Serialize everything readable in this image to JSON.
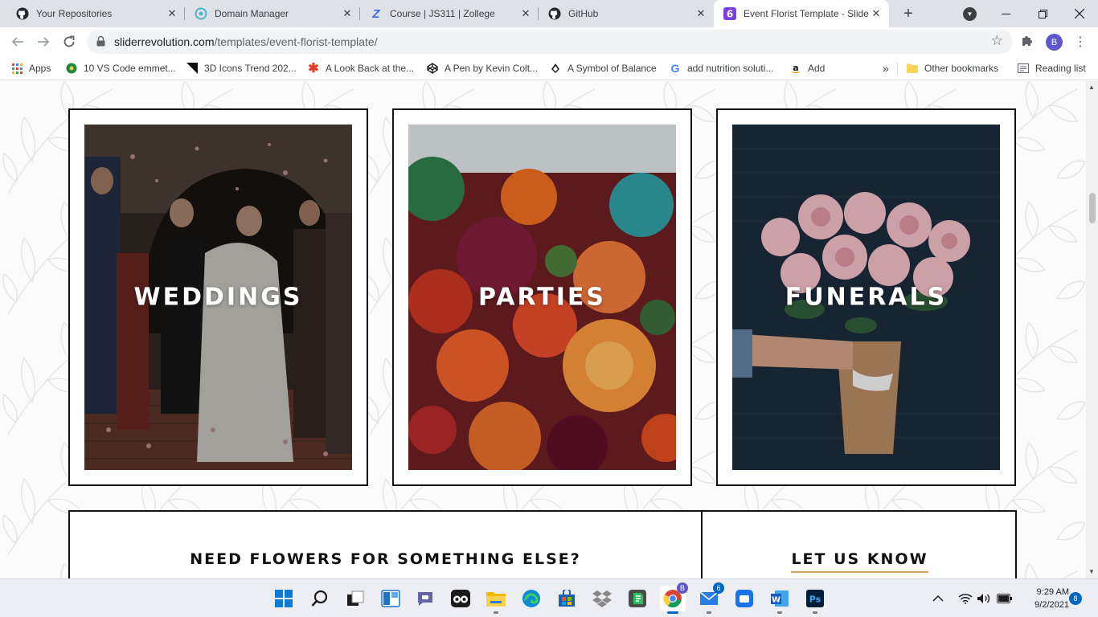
{
  "browser": {
    "tabs": [
      {
        "title": "Your Repositories",
        "icon": "github-icon"
      },
      {
        "title": "Domain Manager",
        "icon": "domain-manager-icon"
      },
      {
        "title": "Course | JS311 | Zollege",
        "icon": "zollege-icon"
      },
      {
        "title": "GitHub",
        "icon": "github-icon"
      },
      {
        "title": "Event Florist Template - Slide",
        "icon": "slider-revolution-icon",
        "active": true
      }
    ],
    "new_tab_label": "+",
    "url_host": "sliderrevolution.com",
    "url_path": "/templates/event-florist-template/",
    "profile_initial": "B"
  },
  "bookmarks": {
    "items": [
      {
        "label": "Apps",
        "icon": "apps-grid-icon"
      },
      {
        "label": "10 VS Code emmet...",
        "icon": "vs-emmet-icon"
      },
      {
        "label": "3D Icons Trend 202...",
        "icon": "3d-icons-icon"
      },
      {
        "label": "A Look Back at the...",
        "icon": "asterisk-icon"
      },
      {
        "label": "A Pen by Kevin Colt...",
        "icon": "codepen-icon"
      },
      {
        "label": "A Symbol of Balance",
        "icon": "balance-icon"
      },
      {
        "label": "add nutrition soluti...",
        "icon": "google-icon"
      },
      {
        "label": "Add",
        "icon": "amazon-icon"
      }
    ],
    "overflow": "»",
    "other_label": "Other bookmarks",
    "reading_list_label": "Reading list"
  },
  "page": {
    "cards": [
      {
        "label": "WEDDINGS"
      },
      {
        "label": "PARTIES"
      },
      {
        "label": "FUNERALS"
      }
    ],
    "need_heading": "NEED FLOWERS FOR SOMETHING ELSE?",
    "let_us_know": "LET US KNOW",
    "accent_color": "#c9a65a"
  },
  "taskbar": {
    "time": "9:29 AM",
    "date": "9/2/2021",
    "notification_count": "8",
    "mail_badge": "6",
    "chrome_badge": "B",
    "apps": [
      "start-icon",
      "search-icon",
      "task-view-icon",
      "widgets-icon",
      "teams-chat-icon",
      "tripadvisor-icon",
      "file-explorer-icon",
      "edge-icon",
      "store-icon",
      "dropbox-icon",
      "evernote-icon",
      "chrome-icon",
      "mail-icon",
      "app-icon",
      "word-icon",
      "photoshop-icon"
    ]
  }
}
